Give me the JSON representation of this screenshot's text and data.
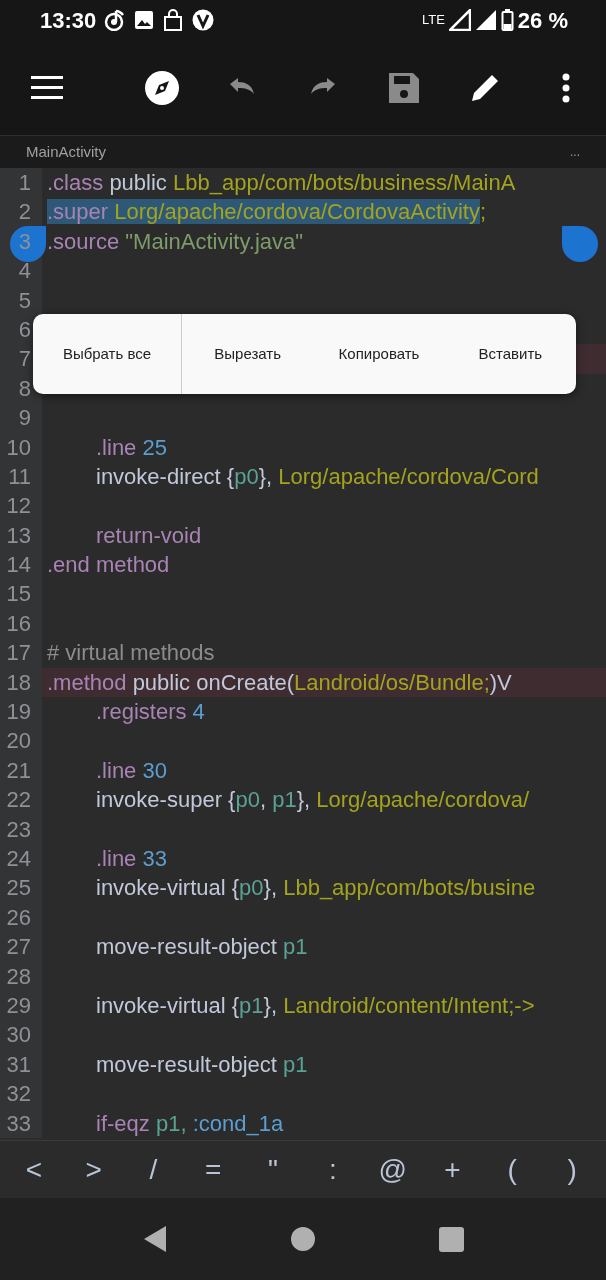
{
  "status_bar": {
    "time": "13:30",
    "network": "LTE",
    "battery": "26 %"
  },
  "toolbar": [
    {
      "kind": "menu",
      "disabled": false
    },
    {
      "kind": "navigate",
      "disabled": false
    },
    {
      "kind": "undo",
      "disabled": true
    },
    {
      "kind": "redo",
      "disabled": true
    },
    {
      "kind": "save",
      "disabled": true
    },
    {
      "kind": "edit",
      "disabled": false
    },
    {
      "kind": "more",
      "disabled": false
    }
  ],
  "tabs": [
    {
      "label": "MainActivity",
      "selected": true
    }
  ],
  "tab_more": "...",
  "lines": [
    {
      "number": "1",
      "highlighted": false,
      "tokens": [
        {
          "kind": "keyword",
          "text": ".class"
        },
        {
          "kind": "plain",
          "text": "public"
        },
        {
          "kind": "type",
          "text": "Lbb_app/com/bots/business/MainA"
        }
      ]
    },
    {
      "number": "2",
      "highlighted": false,
      "tokens": [
        {
          "kind": "keyword",
          "text": ".super",
          "selected": true
        },
        {
          "kind": "type",
          "text": "Lorg/apache/cordova/CordovaActivity",
          "selected": true
        },
        {
          "kind": "type",
          "text": ";",
          "selected": false,
          "join": true
        }
      ]
    },
    {
      "number": "3",
      "highlighted": false,
      "tokens": [
        {
          "kind": "keyword",
          "text": ".source"
        },
        {
          "kind": "string",
          "text": "\"MainActivity.java\""
        }
      ]
    },
    {
      "number": "4",
      "highlighted": false
    },
    {
      "number": "5",
      "highlighted": false
    },
    {
      "number": "6",
      "highlighted": false
    },
    {
      "number": "7",
      "highlighted": true
    },
    {
      "number": "8",
      "highlighted": false
    },
    {
      "number": "9",
      "highlighted": false
    },
    {
      "number": "10",
      "highlighted": false,
      "indent": true,
      "tokens": [
        {
          "kind": "keyword",
          "text": ".line"
        },
        {
          "kind": "number",
          "text": "25"
        }
      ]
    },
    {
      "number": "11",
      "highlighted": false,
      "indent": true,
      "tokens": [
        {
          "kind": "plain",
          "text": "invoke-direct"
        },
        {
          "kind": "plain",
          "text": "{"
        },
        {
          "kind": "register",
          "text": "p0",
          "join": true
        },
        {
          "kind": "plain",
          "text": "},",
          "join": true
        },
        {
          "kind": "type",
          "text": "Lorg/apache/cordova/Cord"
        }
      ]
    },
    {
      "number": "12",
      "highlighted": false
    },
    {
      "number": "13",
      "highlighted": false,
      "indent": true,
      "tokens": [
        {
          "kind": "keyword",
          "text": "return-void"
        }
      ]
    },
    {
      "number": "14",
      "highlighted": false,
      "tokens": [
        {
          "kind": "keyword",
          "text": ".end"
        },
        {
          "kind": "keyword",
          "text": "method"
        }
      ]
    },
    {
      "number": "15",
      "highlighted": false
    },
    {
      "number": "16",
      "highlighted": false
    },
    {
      "number": "17",
      "highlighted": false,
      "tokens": [
        {
          "kind": "comment",
          "text": "# virtual methods"
        }
      ]
    },
    {
      "number": "18",
      "highlighted": true,
      "tokens": [
        {
          "kind": "keyword",
          "text": ".method"
        },
        {
          "kind": "plain",
          "text": "public"
        },
        {
          "kind": "plain",
          "text": "onCreate("
        },
        {
          "kind": "type",
          "text": "Landroid/os/Bundle;",
          "join": true
        },
        {
          "kind": "plain",
          "text": ")V",
          "join": true
        }
      ]
    },
    {
      "number": "19",
      "highlighted": false,
      "indent": true,
      "tokens": [
        {
          "kind": "keyword",
          "text": ".registers"
        },
        {
          "kind": "number",
          "text": "4"
        }
      ]
    },
    {
      "number": "20",
      "highlighted": false
    },
    {
      "number": "21",
      "highlighted": false,
      "indent": true,
      "tokens": [
        {
          "kind": "keyword",
          "text": ".line"
        },
        {
          "kind": "number",
          "text": "30"
        }
      ]
    },
    {
      "number": "22",
      "highlighted": false,
      "indent": true,
      "tokens": [
        {
          "kind": "plain",
          "text": "invoke-super"
        },
        {
          "kind": "plain",
          "text": "{"
        },
        {
          "kind": "register",
          "text": "p0",
          "join": true
        },
        {
          "kind": "plain",
          "text": ",",
          "join": true
        },
        {
          "kind": "register",
          "text": "p1"
        },
        {
          "kind": "plain",
          "text": "},",
          "join": true
        },
        {
          "kind": "type",
          "text": "Lorg/apache/cordova/"
        }
      ]
    },
    {
      "number": "23",
      "highlighted": false
    },
    {
      "number": "24",
      "highlighted": false,
      "indent": true,
      "tokens": [
        {
          "kind": "keyword",
          "text": ".line"
        },
        {
          "kind": "number",
          "text": "33"
        }
      ]
    },
    {
      "number": "25",
      "highlighted": false,
      "indent": true,
      "tokens": [
        {
          "kind": "plain",
          "text": "invoke-virtual"
        },
        {
          "kind": "plain",
          "text": "{"
        },
        {
          "kind": "register",
          "text": "p0",
          "join": true
        },
        {
          "kind": "plain",
          "text": "},",
          "join": true
        },
        {
          "kind": "type",
          "text": "Lbb_app/com/bots/busine"
        }
      ]
    },
    {
      "number": "26",
      "highlighted": false
    },
    {
      "number": "27",
      "highlighted": false,
      "indent": true,
      "tokens": [
        {
          "kind": "plain",
          "text": "move-result-object"
        },
        {
          "kind": "register",
          "text": "p1"
        }
      ]
    },
    {
      "number": "28",
      "highlighted": false
    },
    {
      "number": "29",
      "highlighted": false,
      "indent": true,
      "tokens": [
        {
          "kind": "plain",
          "text": "invoke-virtual"
        },
        {
          "kind": "plain",
          "text": "{"
        },
        {
          "kind": "register",
          "text": "p1",
          "join": true
        },
        {
          "kind": "plain",
          "text": "},",
          "join": true
        },
        {
          "kind": "type",
          "text": "Landroid/content/Intent;->"
        }
      ]
    },
    {
      "number": "30",
      "highlighted": false
    },
    {
      "number": "31",
      "highlighted": false,
      "indent": true,
      "tokens": [
        {
          "kind": "plain",
          "text": "move-result-object"
        },
        {
          "kind": "register",
          "text": "p1"
        }
      ]
    },
    {
      "number": "32",
      "highlighted": false
    },
    {
      "number": "33",
      "highlighted": false,
      "indent": true,
      "tokens": [
        {
          "kind": "keyword",
          "text": "if-eqz"
        },
        {
          "kind": "register",
          "text": "p1,"
        },
        {
          "kind": "number",
          "text": ":cond_1a"
        }
      ]
    }
  ],
  "context_menu": [
    "Выбрать все",
    "Вырезать",
    "Копировать",
    "Вставить"
  ],
  "symbol_keys": [
    "<",
    ">",
    "/",
    "=",
    "\"",
    ":",
    "@",
    "+",
    "(",
    ")"
  ],
  "nav_bar": [
    {
      "kind": "back"
    },
    {
      "kind": "home"
    },
    {
      "kind": "recents"
    }
  ]
}
